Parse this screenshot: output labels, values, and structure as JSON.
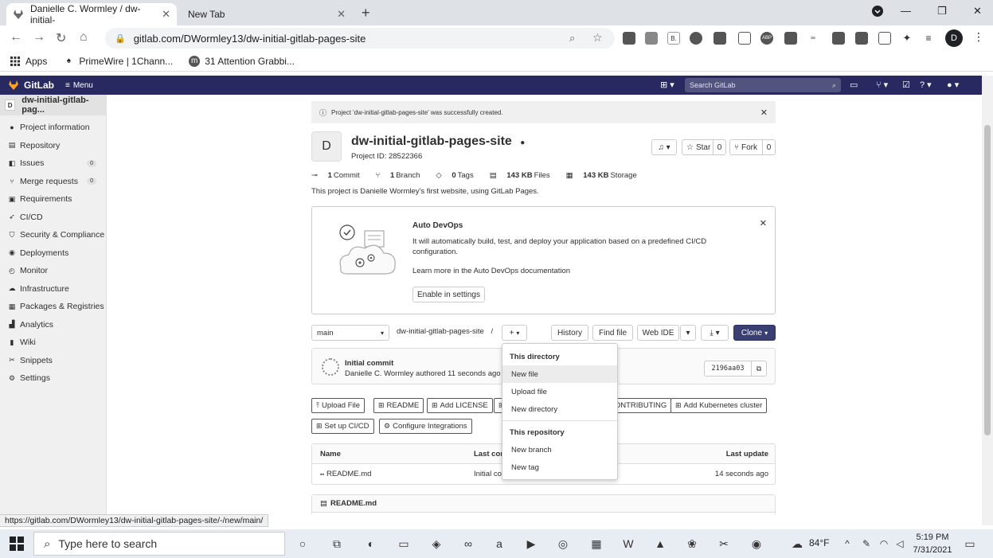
{
  "browser": {
    "tabs": [
      {
        "title": "Danielle C. Wormley / dw-initial-",
        "active": true
      },
      {
        "title": "New Tab",
        "active": false
      }
    ],
    "url": "gitlab.com/DWormley13/dw-initial-gitlab-pages-site",
    "profile_initial": "D",
    "bookmarks": [
      {
        "label": "Apps",
        "icon": "apps-grid-icon"
      },
      {
        "label": "PrimeWire | 1Chann...",
        "icon": "primewire-icon"
      },
      {
        "label": "31 Attention Grabbi...",
        "icon": "bookmark-site-icon"
      }
    ],
    "extensions": [
      "B.",
      "ABP"
    ]
  },
  "gitlab": {
    "brand": "GitLab",
    "menu_label": "Menu",
    "search_placeholder": "Search GitLab",
    "accent": "#292961"
  },
  "sidebar": {
    "project_initial": "D",
    "project_name": "dw-initial-gitlab-pag...",
    "items": [
      {
        "label": "Project information",
        "icon": "info-icon"
      },
      {
        "label": "Repository",
        "icon": "doc-icon"
      },
      {
        "label": "Issues",
        "icon": "issues-icon",
        "count": "0"
      },
      {
        "label": "Merge requests",
        "icon": "merge-icon",
        "count": "0"
      },
      {
        "label": "Requirements",
        "icon": "requirements-icon"
      },
      {
        "label": "CI/CD",
        "icon": "rocket-icon"
      },
      {
        "label": "Security & Compliance",
        "icon": "shield-icon"
      },
      {
        "label": "Deployments",
        "icon": "deploy-icon"
      },
      {
        "label": "Monitor",
        "icon": "monitor-icon"
      },
      {
        "label": "Infrastructure",
        "icon": "cloud-icon"
      },
      {
        "label": "Packages & Registries",
        "icon": "package-icon"
      },
      {
        "label": "Analytics",
        "icon": "chart-icon"
      },
      {
        "label": "Wiki",
        "icon": "book-icon"
      },
      {
        "label": "Snippets",
        "icon": "scissors-icon"
      },
      {
        "label": "Settings",
        "icon": "gear-icon"
      }
    ]
  },
  "alert": {
    "text": "Project 'dw-initial-gitlab-pages-site' was successfully created."
  },
  "project": {
    "avatar": "D",
    "title": "dw-initial-gitlab-pages-site",
    "id_text": "Project ID: 28522366",
    "star_label": "Star",
    "star_count": "0",
    "fork_label": "Fork",
    "fork_count": "0",
    "stats": [
      {
        "bold": "1",
        "label": "Commit"
      },
      {
        "bold": "1",
        "label": "Branch"
      },
      {
        "bold": "0",
        "label": "Tags"
      },
      {
        "bold": "143 KB",
        "label": "Files"
      },
      {
        "bold": "143 KB",
        "label": "Storage"
      }
    ],
    "description": "This project is Danielle Wormley's first website, using GitLab Pages."
  },
  "devops": {
    "title": "Auto DevOps",
    "text": "It will automatically build, test, and deploy your application based on a predefined CI/CD configuration.",
    "learn": "Learn more in the Auto DevOps documentation",
    "enable_label": "Enable in settings"
  },
  "repo_bar": {
    "branch": "main",
    "path": "dw-initial-gitlab-pages-site",
    "separator": "/",
    "add_label": "+",
    "history": "History",
    "find_file": "Find file",
    "web_ide": "Web IDE",
    "clone": "Clone"
  },
  "commit": {
    "message": "Initial commit",
    "author": "Danielle C. Wormley authored 11 seconds ago",
    "sha": "2196aa03"
  },
  "quick_actions": {
    "row1": [
      "Upload File",
      "README",
      "Add LICENSE",
      "",
      "CONTRIBUTING",
      "Add Kubernetes cluster"
    ],
    "row2": [
      "Set up CI/CD",
      "Configure Integrations"
    ]
  },
  "files": {
    "headers": {
      "name": "Name",
      "last_commit": "Last commit",
      "last_update": "Last update"
    },
    "rows": [
      {
        "name": "README.md",
        "commit": "Initial commit",
        "updated": "14 seconds ago"
      }
    ]
  },
  "readme": {
    "title": "README.md"
  },
  "dropdown": {
    "section1": "This directory",
    "items1": [
      "New file",
      "Upload file",
      "New directory"
    ],
    "section2": "This repository",
    "items2": [
      "New branch",
      "New tag"
    ]
  },
  "status_url": "https://gitlab.com/DWormley13/dw-initial-gitlab-pages-site/-/new/main/",
  "taskbar": {
    "search_placeholder": "Type here to search",
    "temperature": "84°F",
    "time": "5:19 PM",
    "date": "7/31/2021"
  }
}
